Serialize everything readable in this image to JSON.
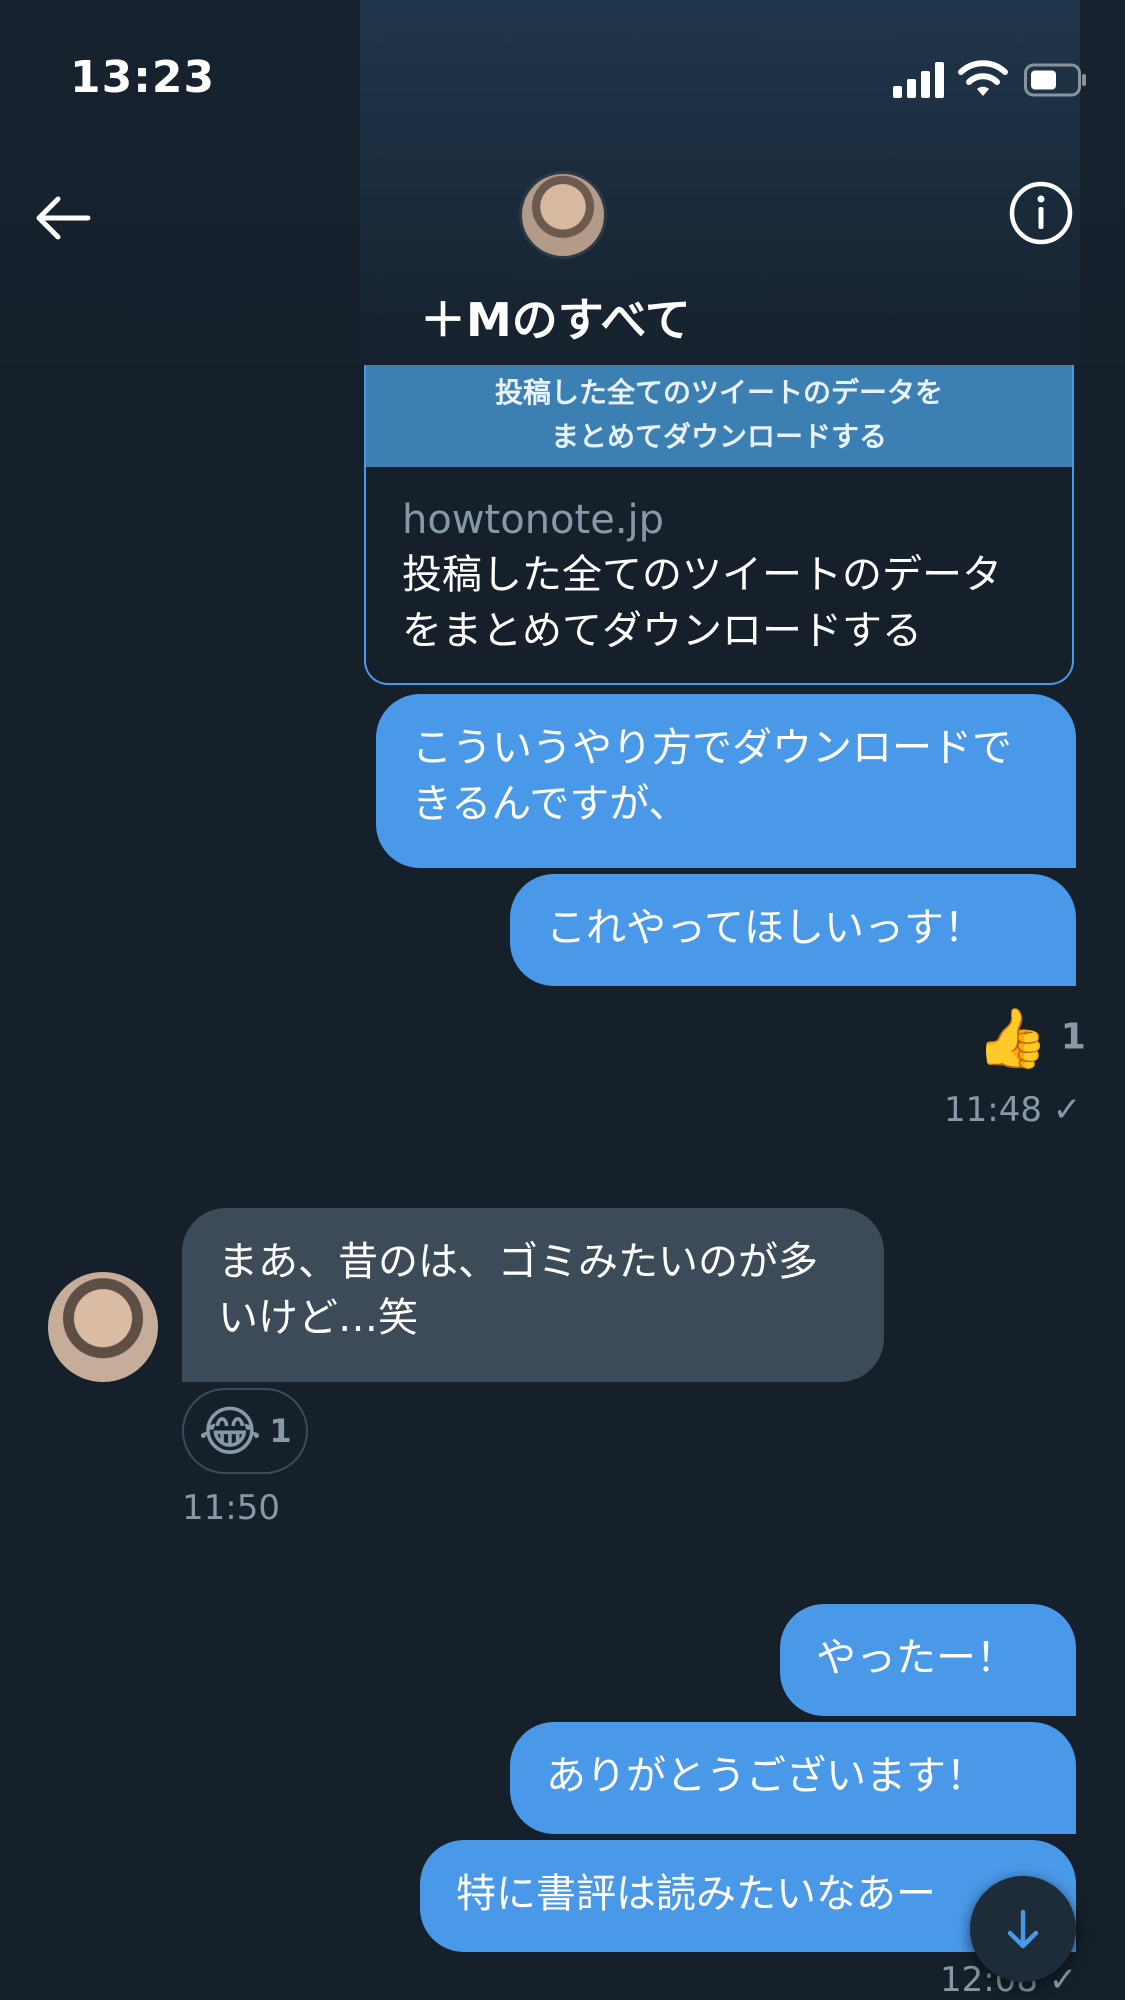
{
  "status_bar": {
    "time": "13:23"
  },
  "header": {
    "title": "＋Mのすべて"
  },
  "link_card": {
    "thumb_text_line1": "投稿した全てのツイートのデータを",
    "thumb_text_line2": "まとめてダウンロードする",
    "domain": "howtonote.jp",
    "description": "投稿した全てのツイートのデータをまとめてダウンロードする"
  },
  "messages": [
    {
      "direction": "out",
      "text": "こういうやり方でダウンロードできるんですが、"
    },
    {
      "direction": "out",
      "text": "これやってほしいっす！",
      "reaction": {
        "emoji": "👍",
        "count": "1"
      },
      "time": "11:48 ✓"
    },
    {
      "direction": "in",
      "text": "まあ、昔のは、ゴミみたいのが多いけど…笑",
      "reaction": {
        "emoji": "😂",
        "count": "1"
      },
      "time": "11:50"
    },
    {
      "direction": "out",
      "text": "やったー！"
    },
    {
      "direction": "out",
      "text": "ありがとうございます！"
    },
    {
      "direction": "out",
      "text": "特に書評は読みたいなあー",
      "time": "12:08 ✓"
    }
  ],
  "colors": {
    "background": "#15202b",
    "bubble_out": "#4a99e9",
    "bubble_in": "#3d4a58",
    "secondary_text": "#8899a6"
  },
  "icons": {
    "back": "arrow-left-icon",
    "info": "info-icon",
    "scroll_down": "arrow-down-icon"
  }
}
